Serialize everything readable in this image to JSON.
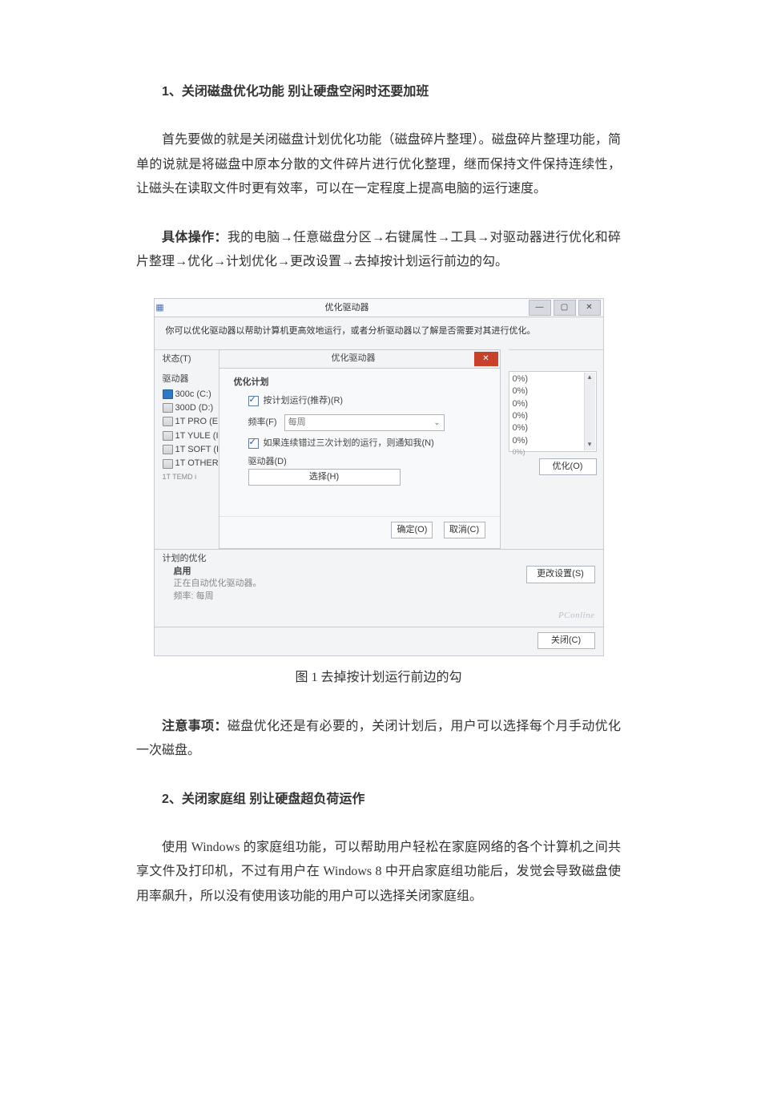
{
  "section1": {
    "heading": "1、关闭磁盘优化功能 别让硬盘空闲时还要加班",
    "para1": "首先要做的就是关闭磁盘计划优化功能（磁盘碎片整理）。磁盘碎片整理功能，简单的说就是将磁盘中原本分散的文件碎片进行优化整理，继而保持文件保持连续性，让磁头在读取文件时更有效率，可以在一定程度上提高电脑的运行速度。",
    "op_label": "具体操作：",
    "op_text": "我的电脑→任意磁盘分区→右键属性→工具→对驱动器进行优化和碎片整理→优化→计划优化→更改设置→去掉按计划运行前边的勾。",
    "fig_caption": "图 1 去掉按计划运行前边的勾",
    "note_label": "注意事项：",
    "note_text": "磁盘优化还是有必要的，关闭计划后，用户可以选择每个月手动优化一次磁盘。"
  },
  "section2": {
    "heading": "2、关闭家庭组 别让硬盘超负荷运作",
    "para1": "使用 Windows 的家庭组功能，可以帮助用户轻松在家庭网络的各个计算机之间共享文件及打印机，不过有用户在 Windows 8 中开启家庭组功能后，发觉会导致磁盘使用率飙升，所以没有使用该功能的用户可以选择关闭家庭组。"
  },
  "screenshot": {
    "main_title": "优化驱动器",
    "description": "你可以优化驱动器以帮助计算机更高效地运行，或者分析驱动器以了解是否需要对其进行优化。",
    "state_label": "状态(T)",
    "drives_header": "驱动器",
    "drives": [
      "300c (C:)",
      "300D (D:)",
      "1T PRO (E",
      "1T YULE (I",
      "1T SOFT (I",
      "1T OTHER",
      "1T TEMD i"
    ],
    "modal": {
      "title": "优化驱动器",
      "plan_group": "优化计划",
      "run_on_schedule": "按计划运行(推荐)(R)",
      "freq_label": "频率(F)",
      "freq_value": "每周",
      "notify_label": "如果连续错过三次计划的运行，则通知我(N)",
      "drives_label": "驱动器(D)",
      "select_btn": "选择(H)",
      "ok_btn": "确定(O)",
      "cancel_btn": "取消(C)"
    },
    "right_list": [
      "0%)",
      "0%)",
      "0%)",
      "0%)",
      "0%)",
      "0%)",
      "0%)"
    ],
    "optimize_btn": "优化(O)",
    "plan_section_label": "计划的优化",
    "enable_label": "启用",
    "running_text": "正在自动优化驱动器。",
    "freq_line": "频率: 每周",
    "change_settings_btn": "更改设置(S)",
    "close_btn": "关闭(C)",
    "watermark": "PConline"
  }
}
